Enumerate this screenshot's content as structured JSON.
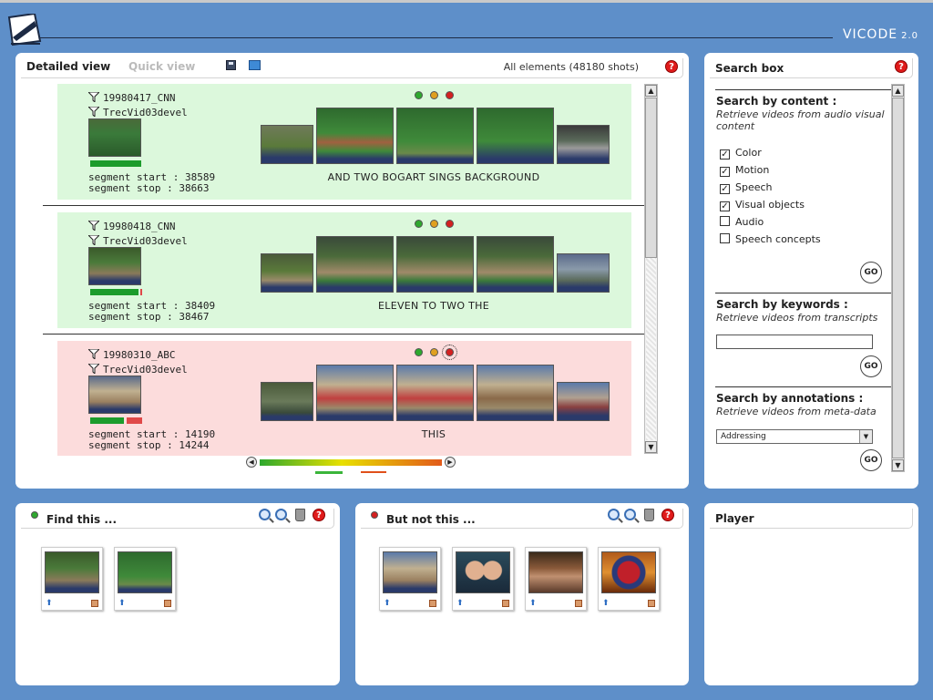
{
  "brand": {
    "name": "VICODE",
    "version": "2.0"
  },
  "main": {
    "tab_detailed": "Detailed view",
    "tab_quick": "Quick view",
    "all_elements": "All elements (48180 shots)",
    "help": "?",
    "segments": [
      {
        "channel": "19980417_CNN",
        "collection": "TrecVid03devel",
        "start": "segment start : 38589",
        "stop": "segment stop : 38663",
        "transcript": "AND TWO BOGART SINGS BACKGROUND",
        "relevance": "green"
      },
      {
        "channel": "19980418_CNN",
        "collection": "TrecVid03devel",
        "start": "segment start : 38409",
        "stop": "segment stop : 38467",
        "transcript": "ELEVEN TO TWO THE",
        "relevance": "green"
      },
      {
        "channel": "19980310_ABC",
        "collection": "TrecVid03devel",
        "start": "segment start : 14190",
        "stop": "segment stop : 14244",
        "transcript": "THIS",
        "relevance": "red"
      }
    ]
  },
  "search": {
    "title": "Search box",
    "help": "?",
    "content_head": "Search by content :",
    "content_desc": "Retrieve videos from audio visual content",
    "options": [
      {
        "label": "Color",
        "checked": true
      },
      {
        "label": "Motion",
        "checked": true
      },
      {
        "label": "Speech",
        "checked": true
      },
      {
        "label": "Visual objects",
        "checked": true
      },
      {
        "label": "Audio",
        "checked": false
      },
      {
        "label": "Speech concepts",
        "checked": false
      }
    ],
    "go": "GO",
    "kw_head": "Search by keywords :",
    "kw_desc": "Retrieve videos from transcripts",
    "kw_value": "",
    "ann_head": "Search by annotations :",
    "ann_desc": "Retrieve videos from meta-data",
    "ann_selected": "Addressing"
  },
  "find": {
    "title": "Find this ...",
    "help": "?"
  },
  "butnot": {
    "title": "But not this ...",
    "help": "?"
  },
  "player": {
    "title": "Player"
  },
  "colors": {
    "accent_bg": "#5e8fc9",
    "positive": "#dcf8dc",
    "negative": "#fcdcdc"
  }
}
